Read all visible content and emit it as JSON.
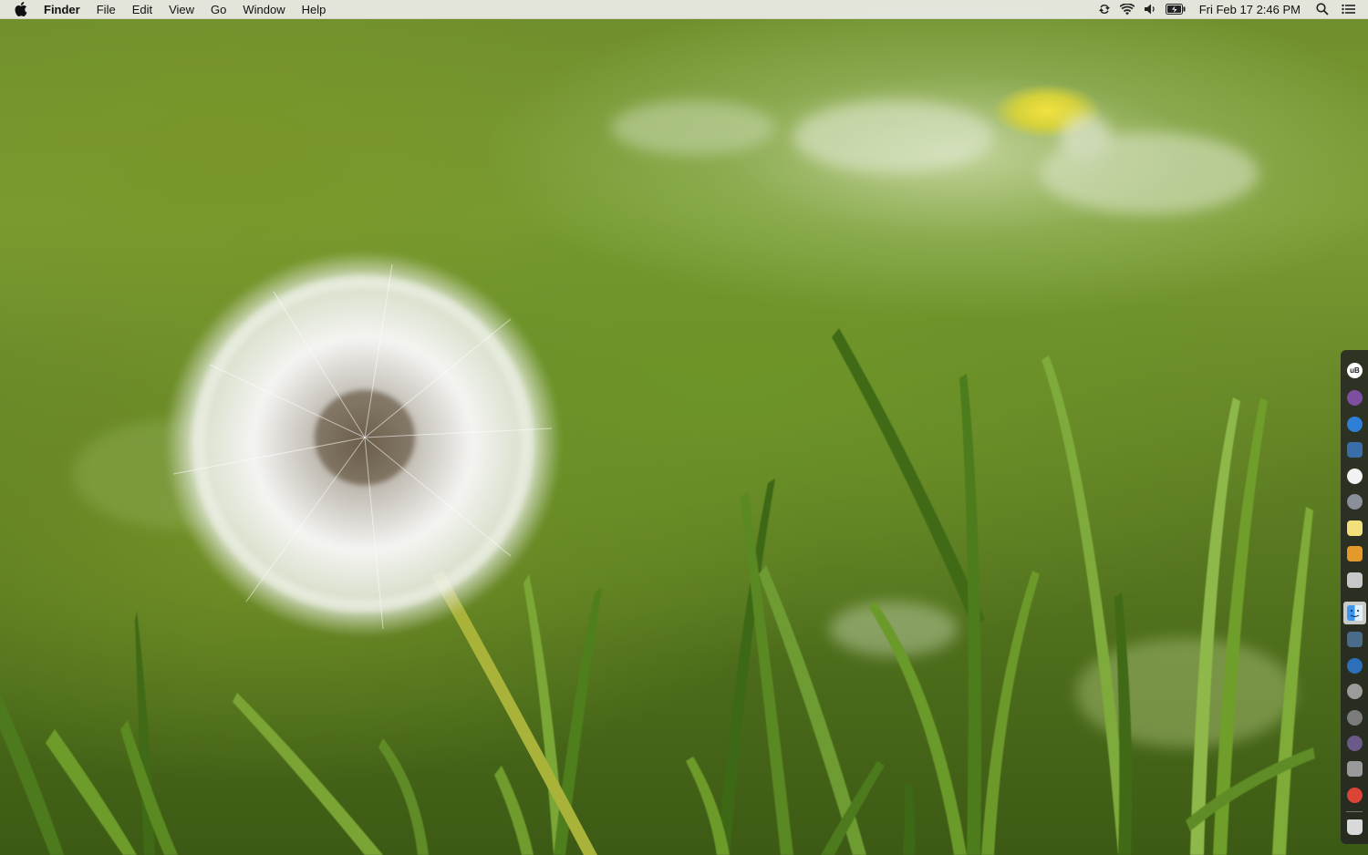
{
  "menubar": {
    "app_name": "Finder",
    "menus": [
      "File",
      "Edit",
      "View",
      "Go",
      "Window",
      "Help"
    ],
    "status_icons": [
      "sync-icon",
      "wifi-icon",
      "volume-icon",
      "battery-icon"
    ],
    "clock": "Fri Feb 17  2:46 PM",
    "right_icons": [
      "spotlight-search-icon",
      "notification-center-icon"
    ]
  },
  "wallpaper": {
    "subject": "dandelion-seed-head-in-grass"
  },
  "dock": {
    "items": [
      {
        "name": "ubar-icon",
        "label": "uB",
        "color": "#ffffff",
        "fg": "#222222"
      },
      {
        "name": "tor-browser-icon",
        "label": "",
        "color": "#7e4fa0",
        "fg": "#ffffff"
      },
      {
        "name": "safari-icon",
        "label": "",
        "color": "#2e7fd6",
        "fg": "#ffffff"
      },
      {
        "name": "preview-icon",
        "label": "",
        "color": "#3a6ea8",
        "fg": "#ffffff"
      },
      {
        "name": "itunes-icon",
        "label": "",
        "color": "#f2f2f2",
        "fg": "#e0336a"
      },
      {
        "name": "system-preferences-icon",
        "label": "",
        "color": "#8a8f99",
        "fg": "#ffffff"
      },
      {
        "name": "notes-icon",
        "label": "",
        "color": "#f3e07a",
        "fg": "#444444"
      },
      {
        "name": "photos-icon",
        "label": "",
        "color": "#e39a2b",
        "fg": "#ffffff"
      },
      {
        "name": "ibooks-icon",
        "label": "",
        "color": "#c8c8c8",
        "fg": "#444444"
      },
      {
        "name": "finder-icon",
        "label": "",
        "color": "#3f96f0",
        "fg": "#ffffff",
        "active": true
      },
      {
        "name": "preview-app-icon",
        "label": "",
        "color": "#4b6b8a",
        "fg": "#ffffff"
      },
      {
        "name": "safari-2-icon",
        "label": "",
        "color": "#2d6fb8",
        "fg": "#ffffff"
      },
      {
        "name": "music-icon",
        "label": "",
        "color": "#9b9b9b",
        "fg": "#ffffff"
      },
      {
        "name": "settings-icon",
        "label": "",
        "color": "#7c7c7c",
        "fg": "#ffffff"
      },
      {
        "name": "tor-icon",
        "label": "",
        "color": "#6a5a8a",
        "fg": "#ffffff"
      },
      {
        "name": "document-icon",
        "label": "",
        "color": "#9a9a9a",
        "fg": "#ffffff"
      },
      {
        "name": "chrome-icon",
        "label": "",
        "color": "#db4437",
        "fg": "#ffffff"
      },
      {
        "name": "trash-icon",
        "label": "",
        "color": "#d9d9d9",
        "fg": "#555555"
      }
    ]
  }
}
